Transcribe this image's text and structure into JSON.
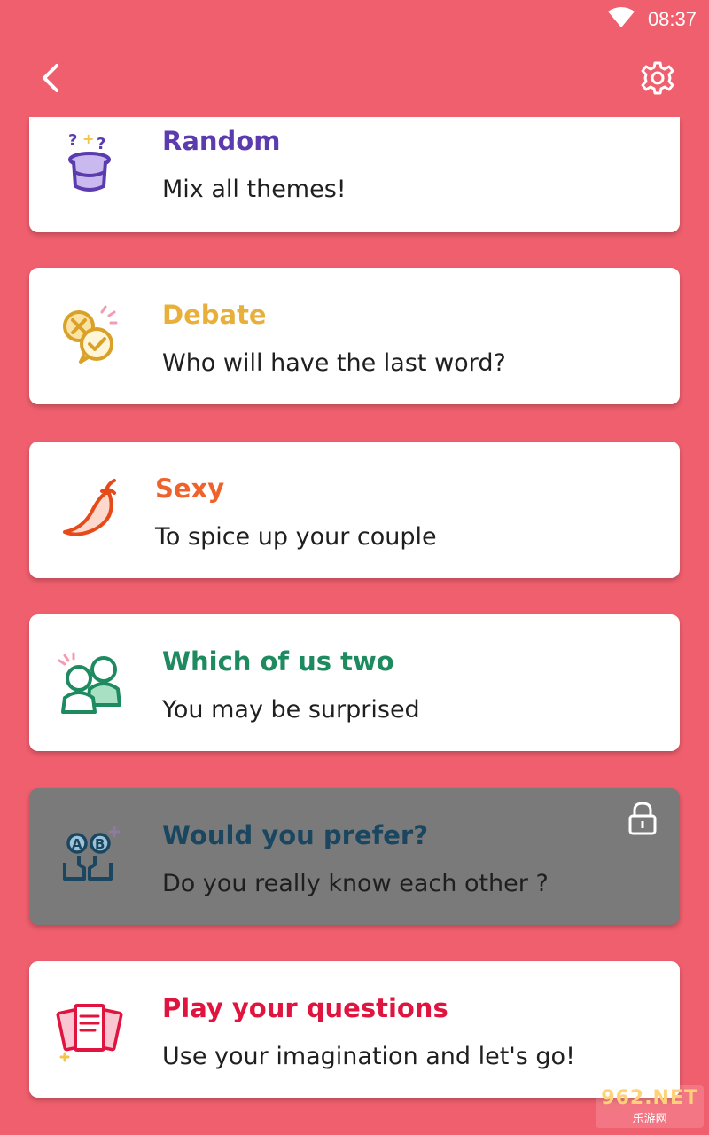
{
  "status_bar": {
    "time": "08:37",
    "wifi_icon": "wifi-icon"
  },
  "app_bar": {
    "back_icon": "back-arrow-icon",
    "settings_icon": "gear-icon"
  },
  "themes": [
    {
      "title": "Random",
      "subtitle": "Mix all themes!",
      "title_color": "#5B3BAE",
      "icon": "magic-hat-icon",
      "locked": false
    },
    {
      "title": "Debate",
      "subtitle": "Who will have the last word?",
      "title_color": "#E8B03A",
      "icon": "debate-bubbles-icon",
      "locked": false
    },
    {
      "title": "Sexy",
      "subtitle": "To spice up your couple",
      "title_color": "#F0622C",
      "icon": "chili-pepper-icon",
      "locked": false
    },
    {
      "title": "Which of us two",
      "subtitle": "You may be surprised",
      "title_color": "#1E8A5F",
      "icon": "two-people-icon",
      "locked": false
    },
    {
      "title": "Would you prefer?",
      "subtitle": "Do you really know each other ?",
      "title_color": "#1A4660",
      "icon": "ab-choice-hands-icon",
      "locked": true,
      "lock_icon": "padlock-icon"
    },
    {
      "title": "Play your questions",
      "subtitle": "Use your imagination and let's go!",
      "title_color": "#E0153F",
      "icon": "question-cards-icon",
      "locked": false
    }
  ],
  "watermark": {
    "main": "962.NET",
    "sub": "乐游网"
  }
}
